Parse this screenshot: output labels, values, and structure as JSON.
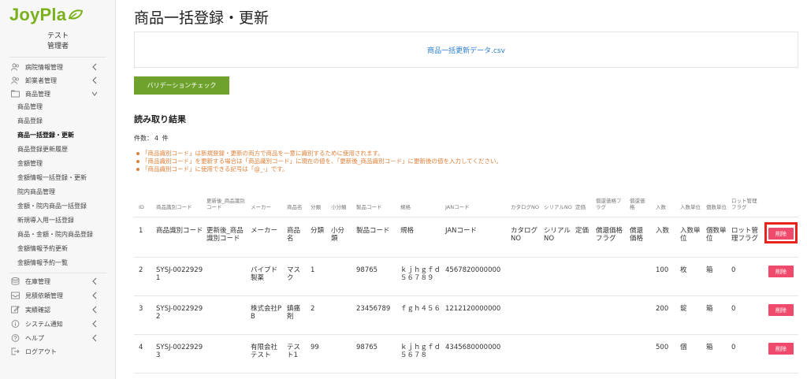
{
  "app": {
    "logo": "JoyPla"
  },
  "user": {
    "org": "テスト",
    "role": "管理者"
  },
  "sidebar": {
    "sections": [
      {
        "label": "病院情報管理"
      },
      {
        "label": "卸業者管理"
      },
      {
        "label": "商品管理"
      }
    ],
    "sub_items": [
      {
        "label": "商品管理"
      },
      {
        "label": "商品登録"
      },
      {
        "label": "商品一括登録・更新"
      },
      {
        "label": "商品登録更新履歴"
      },
      {
        "label": "金額管理"
      },
      {
        "label": "金額情報一括登録・更新"
      },
      {
        "label": "院内商品管理"
      },
      {
        "label": "金額・院内商品一括登録"
      },
      {
        "label": "新規導入用一括登録"
      },
      {
        "label": "商品・金額・院内商品登録"
      },
      {
        "label": "金額情報予約更新"
      },
      {
        "label": "金額情報予約一覧"
      }
    ],
    "bottom_sections": [
      {
        "label": "在庫管理"
      },
      {
        "label": "見積依頼管理"
      },
      {
        "label": "実績確認"
      },
      {
        "label": "システム通知"
      },
      {
        "label": "ヘルプ"
      },
      {
        "label": "ログアウト"
      }
    ]
  },
  "main": {
    "title": "商品一括登録・更新",
    "file_name": "商品一括更新データ.csv",
    "validate_button": "バリデーションチェック",
    "results_title": "読み取り結果",
    "count_label": "件数：",
    "count_value": "4",
    "count_unit": "件",
    "notes": [
      "「商品識別コード」は新規登録・更新の両方で商品を一意に識別するために使用されます。",
      "「商品識別コード」を更新する場合は「商品識別コード」に現在の値を、「更新後_商品識別コード」に更新後の値を入力してください。",
      "「商品識別コード」に使用できる記号は「@_-」です。"
    ]
  },
  "table": {
    "headers": [
      "ID",
      "商品識別コード",
      "更新後_商品識別コード",
      "メーカー",
      "商品名",
      "分類",
      "小分類",
      "製品コード",
      "規格",
      "JANコード",
      "カタログNO",
      "シリアルNO",
      "定価",
      "償還価格フラグ",
      "償還価格",
      "入数",
      "入数単位",
      "個数単位",
      "ロット管理フラグ"
    ],
    "rows": [
      [
        "1",
        "商品識別コード",
        "更新後_商品識別コード",
        "メーカー",
        "商品名",
        "分類",
        "小分類",
        "製品コード",
        "規格",
        "JANコード",
        "カタログNO",
        "シリアルNO",
        "定価",
        "償還価格フラグ",
        "償還価格",
        "入数",
        "入数単位",
        "個数単位",
        "ロット管理フラグ"
      ],
      [
        "2",
        "SYSJ-00229291",
        "",
        "パイプド製薬",
        "マスク",
        "1",
        "",
        "98765",
        "ｋｊｈｇｆｄ５６７８９",
        "4567820000000",
        "",
        "",
        "",
        "",
        "",
        "100",
        "枚",
        "箱",
        "0"
      ],
      [
        "3",
        "SYSJ-00229292",
        "",
        "株式会社PB",
        "鎮痛剤",
        "2",
        "",
        "23456789",
        "ｆｇｈ４５６",
        "1212120000000",
        "",
        "",
        "",
        "",
        "",
        "200",
        "錠",
        "箱",
        "0"
      ],
      [
        "4",
        "SYSJ-00229293",
        "",
        "有限会社テスト",
        "テスト1",
        "99",
        "",
        "98765",
        "ｋｊｈｇｆｄ５６７８",
        "4345680000000",
        "",
        "",
        "",
        "",
        "",
        "500",
        "個",
        "箱",
        "0"
      ]
    ],
    "delete_label": "削除"
  },
  "colors": {
    "brand": "#7ab11c",
    "validate": "#6ea22d",
    "delete": "#ef4a6b",
    "highlight": "#e8231b",
    "note": "#e0813a",
    "link": "#2a7dd1"
  }
}
